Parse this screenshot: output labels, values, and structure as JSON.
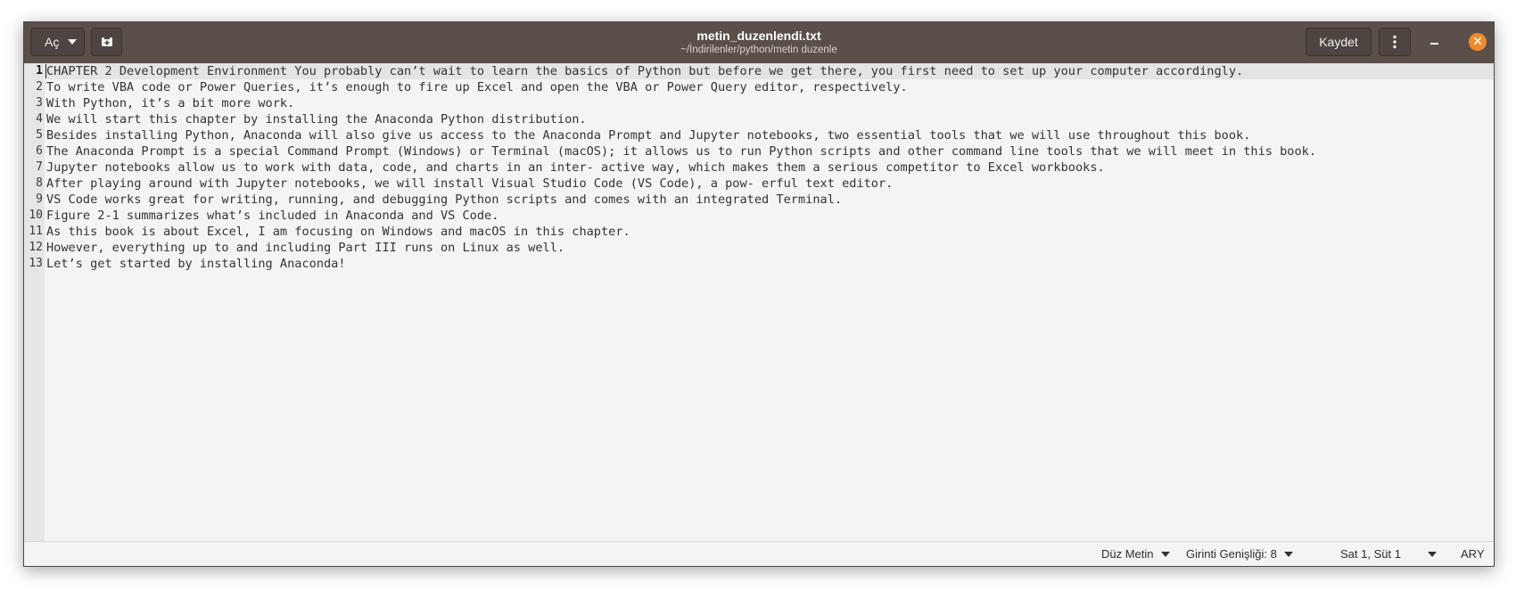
{
  "header": {
    "open_label": "Aç",
    "title": "metin_duzenlendi.txt",
    "subtitle": "~/İndirilenler/python/metin duzenle",
    "save_label": "Kaydet",
    "menu_icon": "three-dots-vertical",
    "close_color": "#ee8a2f"
  },
  "gutter": [
    "1",
    "2",
    "3",
    "4",
    "5",
    "6",
    "7",
    "8",
    "9",
    "10",
    "11",
    "12",
    "13"
  ],
  "lines": [
    "CHAPTER 2 Development Environment You probably can’t wait to learn the basics of Python but before we get there, you first need to set up your computer accordingly.",
    "To write VBA code or Power Queries, it’s enough to fire up Excel and open the VBA or Power Query editor, respectively.",
    "With Python, it’s a bit more work.",
    "We will start this chapter by installing the Anaconda Python distribution.",
    "Besides installing Python, Anaconda will also give us access to the Anaconda Prompt and Jupyter notebooks, two essential tools that we will use throughout this book.",
    "The Anaconda Prompt is a special Command Prompt (Windows) or Terminal (macOS); it allows us to run Python scripts and other command line tools that we will meet in this book.",
    "Jupyter notebooks allow us to work with data, code, and charts in an inter- active way, which makes them a serious competitor to Excel workbooks.",
    "After playing around with Jupyter notebooks, we will install Visual Studio Code (VS Code), a pow- erful text editor.",
    "VS Code works great for writing, running, and debugging Python scripts and comes with an integrated Terminal.",
    "Figure 2-1 summarizes what’s included in Anaconda and VS Code.",
    "As this book is about Excel, I am focusing on Windows and macOS in this chapter.",
    "However, everything up to and including Part III runs on Linux as well.",
    "Let’s get started by installing Anaconda!"
  ],
  "status": {
    "language": "Düz Metin",
    "indent": "Girinti Genişliği: 8",
    "position": "Sat 1, Süt 1",
    "mode": "ARY"
  }
}
